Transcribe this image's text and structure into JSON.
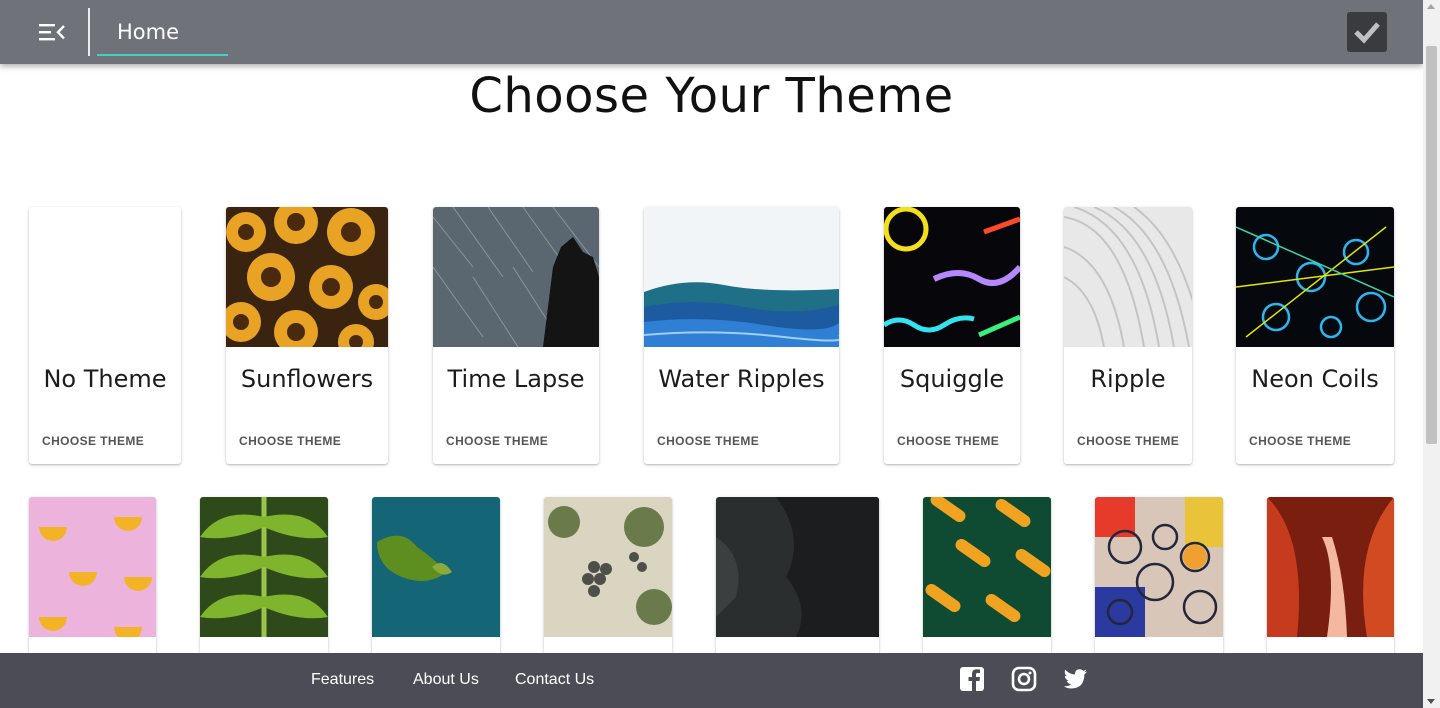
{
  "appbar": {
    "menu_icon": "menu-collapse-icon",
    "home_tab_label": "Home",
    "confirm_icon": "check-icon",
    "background": "#6f7278",
    "accent": "#3fd1c4"
  },
  "page": {
    "title": "Choose Your Theme"
  },
  "themes_row1": [
    {
      "name": "No Theme",
      "action": "CHOOSE THEME"
    },
    {
      "name": "Sunflowers",
      "action": "CHOOSE THEME"
    },
    {
      "name": "Time Lapse",
      "action": "CHOOSE THEME"
    },
    {
      "name": "Water Ripples",
      "action": "CHOOSE THEME"
    },
    {
      "name": "Squiggle",
      "action": "CHOOSE THEME"
    },
    {
      "name": "Ripple",
      "action": "CHOOSE THEME"
    },
    {
      "name": "Neon Coils",
      "action": "CHOOSE THEME"
    }
  ],
  "themes_row2_images": [
    "lemons-image",
    "leaf-image",
    "island-image",
    "grapes-image",
    "dark-rock-image",
    "corn-image",
    "oil-bubbles-image",
    "canyon-image"
  ],
  "footer": {
    "links": [
      "Features",
      "About Us",
      "Contact Us"
    ],
    "social_icons": [
      "facebook-icon",
      "instagram-icon",
      "twitter-icon"
    ],
    "background": "#4b4c55"
  }
}
